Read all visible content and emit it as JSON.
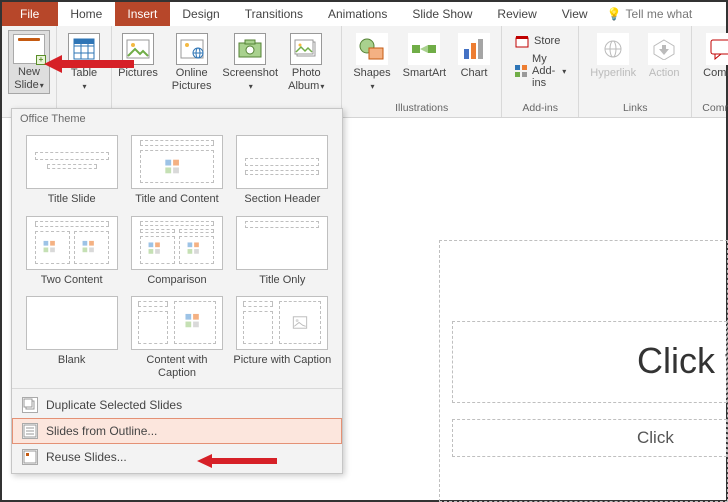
{
  "tabs": {
    "file": "File",
    "home": "Home",
    "insert": "Insert",
    "design": "Design",
    "transitions": "Transitions",
    "animations": "Animations",
    "slideshow": "Slide Show",
    "review": "Review",
    "view": "View",
    "tell": "Tell me what"
  },
  "ribbon": {
    "new_slide": "New Slide",
    "table": "Table",
    "pictures": "Pictures",
    "online_pictures": "Online Pictures",
    "screenshot": "Screenshot",
    "photo_album": "Photo Album",
    "shapes": "Shapes",
    "smartart": "SmartArt",
    "chart": "Chart",
    "store": "Store",
    "my_addins": "My Add-ins",
    "hyperlink": "Hyperlink",
    "action": "Action",
    "comment": "Comme",
    "g_illustrations": "Illustrations",
    "g_addins": "Add-ins",
    "g_links": "Links",
    "g_comment": "Commer"
  },
  "dropdown": {
    "title": "Office Theme",
    "layouts": [
      "Title Slide",
      "Title and Content",
      "Section Header",
      "Two Content",
      "Comparison",
      "Title Only",
      "Blank",
      "Content with Caption",
      "Picture with Caption"
    ],
    "duplicate": "Duplicate Selected Slides",
    "outline": "Slides from Outline...",
    "reuse": "Reuse Slides..."
  },
  "canvas": {
    "title": "Click t",
    "subtitle": "Click"
  }
}
